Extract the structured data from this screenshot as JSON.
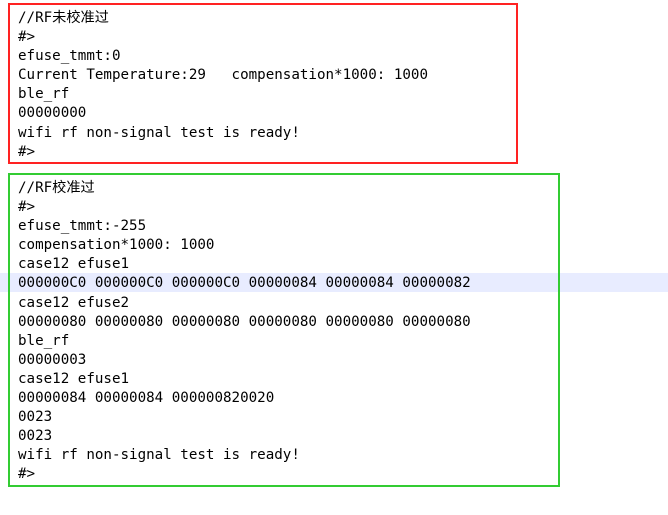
{
  "colors": {
    "calibrated_off_border": "#ff2222",
    "calibrated_on_border": "#33cc33",
    "current_line_highlight": "#e8ecff",
    "text": "#000000"
  },
  "log_uncalibrated": {
    "lines": [
      "//RF未校准过",
      "#>",
      "efuse_tmmt:0",
      "Current Temperature:29   compensation*1000: 1000",
      "ble_rf",
      "00000000",
      "wifi rf non-signal test is ready!",
      "#>"
    ]
  },
  "log_calibrated": {
    "lines": [
      "//RF校准过",
      "#>",
      "efuse_tmmt:-255",
      "compensation*1000: 1000",
      "case12 efuse1",
      "000000C0 000000C0 000000C0 00000084 00000084 00000082",
      "case12 efuse2",
      "00000080 00000080 00000080 00000080 00000080 00000080",
      "ble_rf",
      "00000003",
      "case12 efuse1",
      "00000084 00000084 000000820020",
      "0023",
      "0023",
      "wifi rf non-signal test is ready!",
      "#>"
    ]
  }
}
